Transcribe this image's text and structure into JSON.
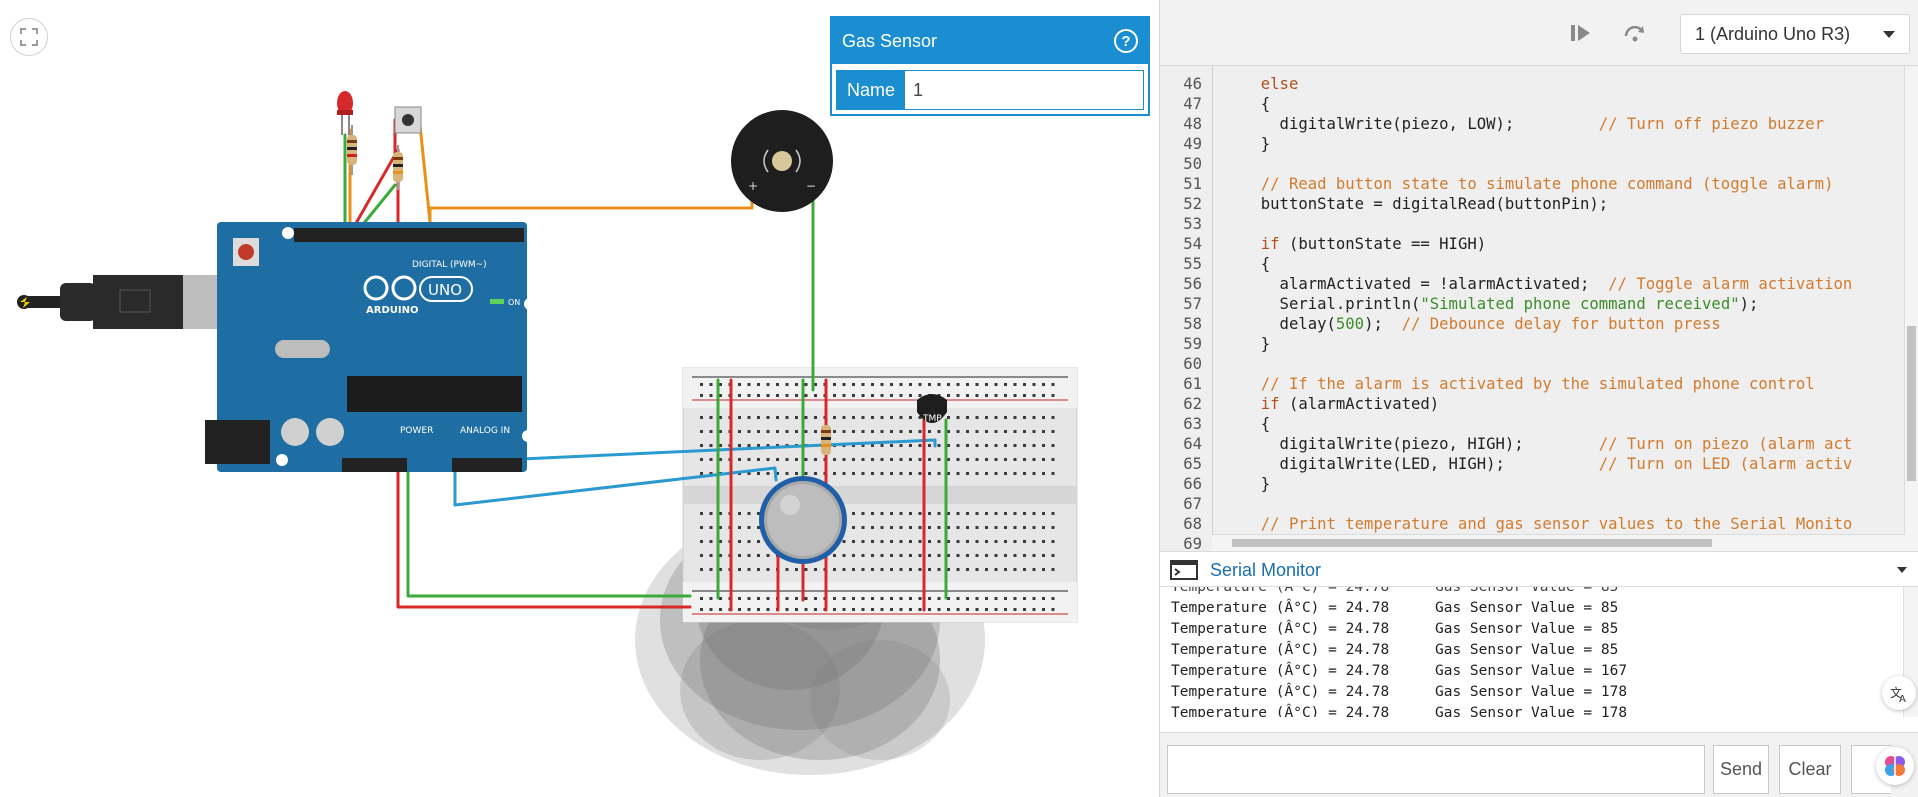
{
  "inspector": {
    "title": "Gas Sensor",
    "help_label": "?",
    "name_label": "Name",
    "name_value": "1"
  },
  "toolbar": {
    "device": "1 (Arduino Uno R3)"
  },
  "circuit": {
    "arduino_digital": "DIGITAL (PWM~)",
    "arduino_brand": "ARDUINO",
    "arduino_model": "UNO",
    "arduino_power": "POWER",
    "arduino_analog": "ANALOG IN",
    "arduino_on": "ON",
    "tmp_label": "TMP"
  },
  "code": {
    "lines": [
      {
        "n": "46",
        "t": "  else"
      },
      {
        "n": "47",
        "t": "  {"
      },
      {
        "n": "48",
        "t": "    digitalWrite(piezo, LOW);         // Turn off piezo buzzer"
      },
      {
        "n": "49",
        "t": "  }"
      },
      {
        "n": "50",
        "t": ""
      },
      {
        "n": "51",
        "t": "  // Read button state to simulate phone command (toggle alarm)"
      },
      {
        "n": "52",
        "t": "  buttonState = digitalRead(buttonPin);"
      },
      {
        "n": "53",
        "t": ""
      },
      {
        "n": "54",
        "t": "  if (buttonState == HIGH)"
      },
      {
        "n": "55",
        "t": "  {"
      },
      {
        "n": "56",
        "t": "    alarmActivated = !alarmActivated;  // Toggle alarm activation"
      },
      {
        "n": "57",
        "t": "    Serial.println(\"Simulated phone command received\");"
      },
      {
        "n": "58",
        "t": "    delay(500);  // Debounce delay for button press"
      },
      {
        "n": "59",
        "t": "  }"
      },
      {
        "n": "60",
        "t": ""
      },
      {
        "n": "61",
        "t": "  // If the alarm is activated by the simulated phone control"
      },
      {
        "n": "62",
        "t": "  if (alarmActivated)"
      },
      {
        "n": "63",
        "t": "  {"
      },
      {
        "n": "64",
        "t": "    digitalWrite(piezo, HIGH);        // Turn on piezo (alarm act"
      },
      {
        "n": "65",
        "t": "    digitalWrite(LED, HIGH);          // Turn on LED (alarm activ"
      },
      {
        "n": "66",
        "t": "  }"
      },
      {
        "n": "67",
        "t": ""
      },
      {
        "n": "68",
        "t": "  // Print temperature and gas sensor values to the Serial Monito"
      },
      {
        "n": "69",
        "t": ""
      }
    ]
  },
  "serial": {
    "title": "Serial Monitor",
    "lines": [
      {
        "a": "Temperature (Â°C) = 24.78",
        "b": "Gas Sensor Value = 85"
      },
      {
        "a": "Temperature (Â°C) = 24.78",
        "b": "Gas Sensor Value = 85"
      },
      {
        "a": "Temperature (Â°C) = 24.78",
        "b": "Gas Sensor Value = 85"
      },
      {
        "a": "Temperature (Â°C) = 24.78",
        "b": "Gas Sensor Value = 167"
      },
      {
        "a": "Temperature (Â°C) = 24.78",
        "b": "Gas Sensor Value = 178"
      },
      {
        "a": "Temperature (Â°C) = 24.78",
        "b": "Gas Sensor Value = 178"
      }
    ],
    "input_placeholder": "",
    "send_label": "Send",
    "clear_label": "Clear"
  },
  "colors": {
    "accent": "#1a8ed0",
    "wire_red": "#d62a2a",
    "wire_green": "#3aaa3a",
    "wire_orange": "#e8901a",
    "wire_blue": "#2a9ad0"
  }
}
